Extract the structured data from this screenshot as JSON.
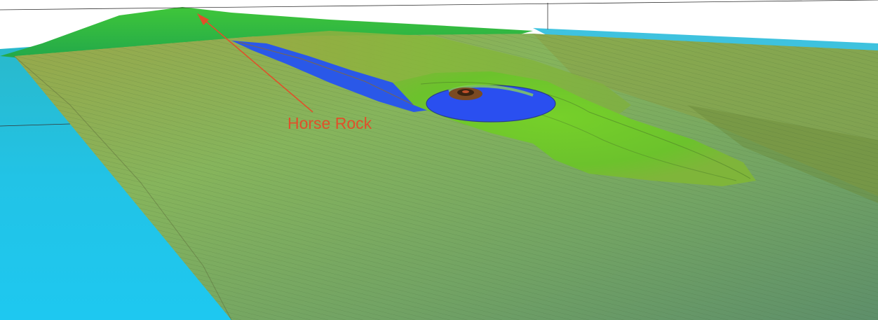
{
  "annotation": {
    "label": "Horse Rock",
    "color": "#e0502a"
  },
  "palette": {
    "shallow_cyan": "#24c6ea",
    "deep_blue": "#1f4de0",
    "terrain_green": "#5fcb2e",
    "terrain_olive": "#8a9a3a",
    "slope_tan": "#88b060",
    "ridge_brown": "#7a4a22"
  }
}
